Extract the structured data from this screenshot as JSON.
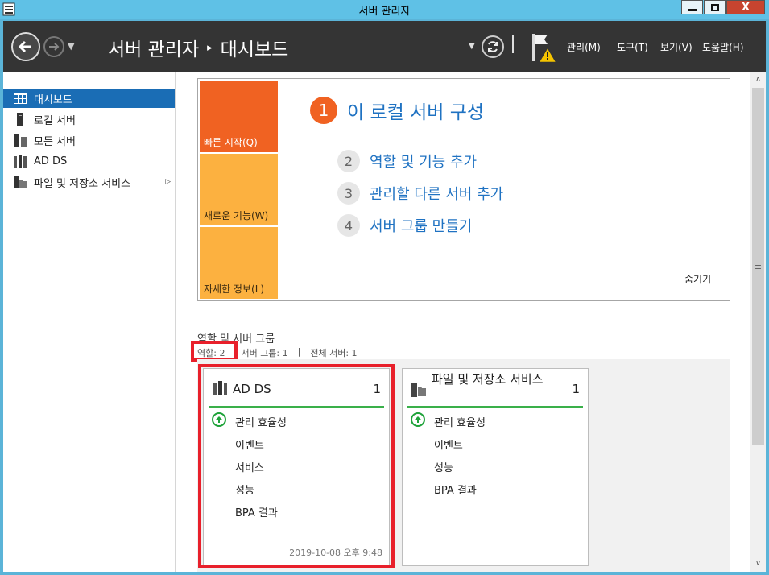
{
  "window": {
    "title": "서버 관리자",
    "minimize": "▁",
    "maximize": "□",
    "close": "X"
  },
  "header": {
    "breadcrumb": [
      "서버 관리자",
      "▸",
      "대시보드"
    ],
    "menus": [
      "관리(M)",
      "도구(T)",
      "보기(V)",
      "도움말(H)"
    ]
  },
  "sidebar": {
    "items": [
      {
        "label": "대시보드",
        "icon": "dashboard-icon",
        "active": true
      },
      {
        "label": "로컬 서버",
        "icon": "local-server-icon"
      },
      {
        "label": "모든 서버",
        "icon": "all-servers-icon"
      },
      {
        "label": "AD DS",
        "icon": "ad-ds-icon"
      },
      {
        "label": "파일 및 저장소 서비스",
        "icon": "file-storage-icon",
        "has_arrow": true
      }
    ]
  },
  "welcome": {
    "tiles": [
      "빠른 시작(Q)",
      "새로운 기능(W)",
      "자세한 정보(L)"
    ],
    "main_step": {
      "num": "1",
      "label": "이 로컬 서버 구성"
    },
    "steps": [
      {
        "num": "2",
        "label": "역할 및 기능 추가"
      },
      {
        "num": "3",
        "label": "관리할 다른 서버 추가"
      },
      {
        "num": "4",
        "label": "서버 그룹 만들기"
      }
    ],
    "hide": "숨기기"
  },
  "roles": {
    "title": "역할 및 서버 그룹",
    "stats": [
      "역할: 2",
      "서버 그룹: 1",
      "전체 서버: 1"
    ],
    "stat_sep": "|"
  },
  "cards": [
    {
      "title": "AD DS",
      "count": "1",
      "rows": [
        "관리 효율성",
        "이벤트",
        "서비스",
        "성능",
        "BPA 결과"
      ],
      "timestamp": "2019-10-08 오후 9:48"
    },
    {
      "title": "파일 및 저장소 서비스",
      "count": "1",
      "rows": [
        "관리 효율성",
        "이벤트",
        "성능",
        "BPA 결과"
      ]
    }
  ],
  "colors": {
    "accent": "#1a6db5",
    "orange": "#f06222",
    "amber": "#fcb140",
    "status_ok": "#1fa33a",
    "highlight": "#e8202b"
  }
}
